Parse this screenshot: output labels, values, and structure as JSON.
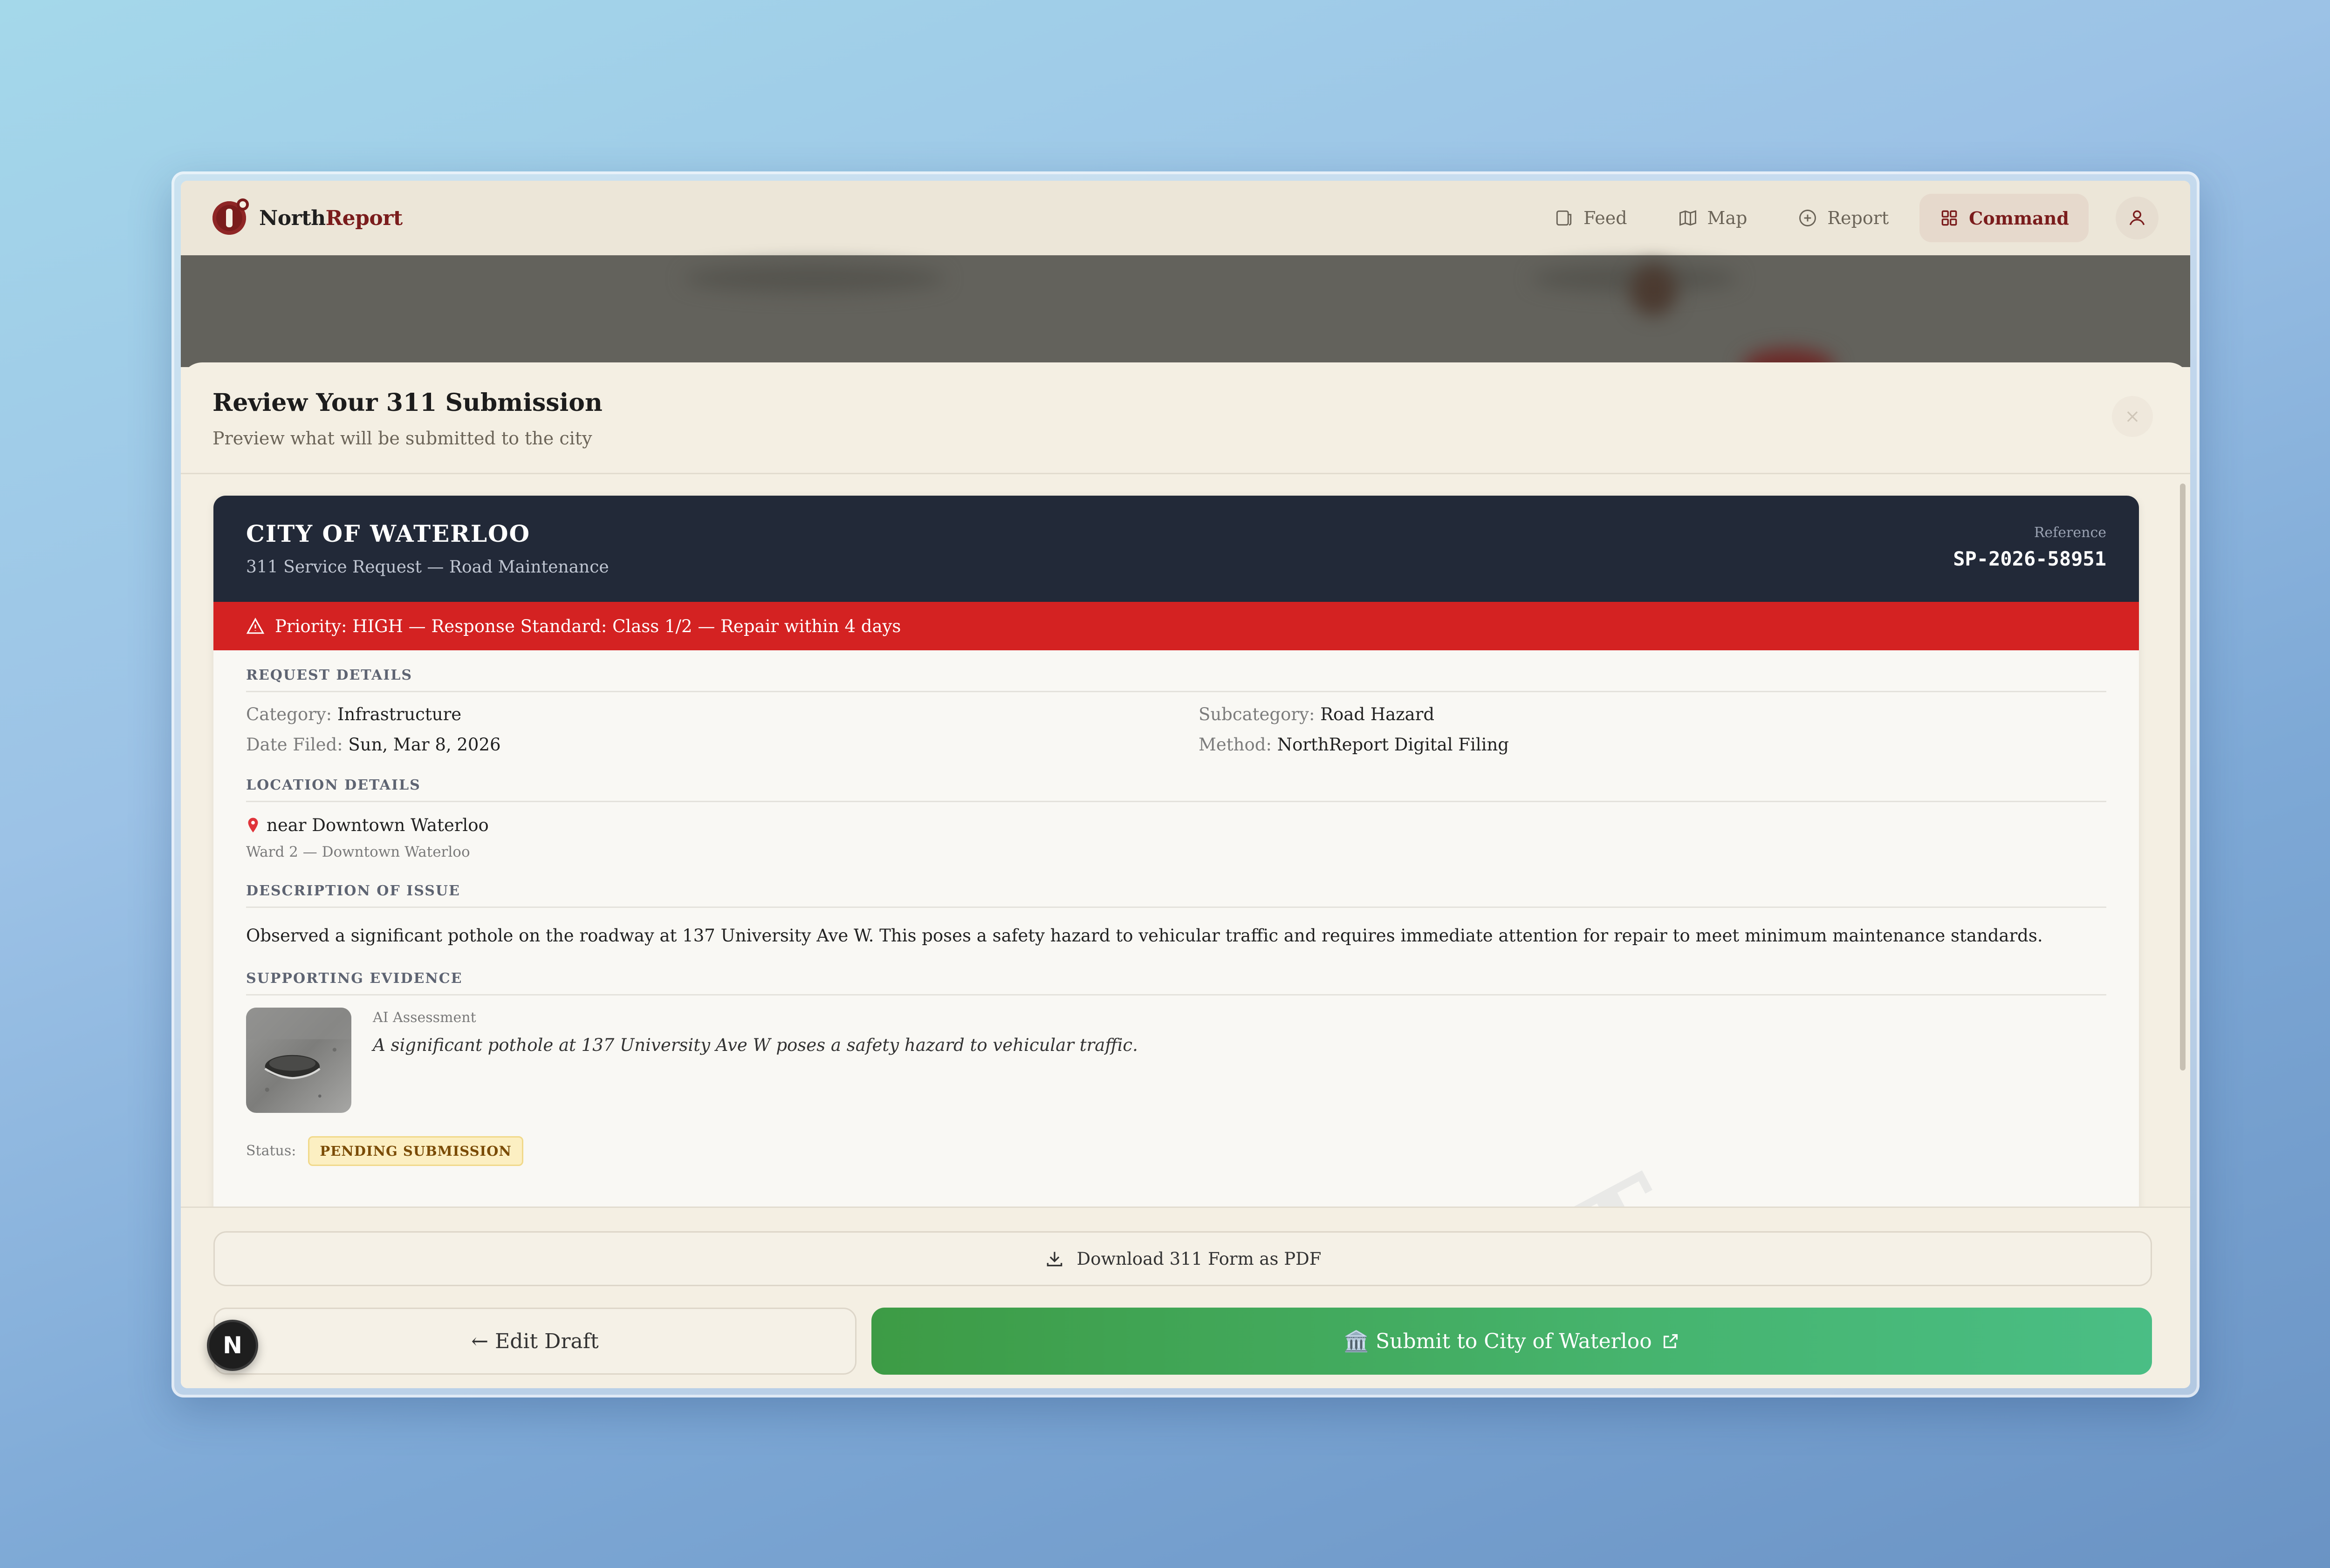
{
  "app": {
    "brand_primary": "North",
    "brand_accent": "Report",
    "accent_color": "#7a1c1c"
  },
  "nav": {
    "items": [
      {
        "label": "Feed",
        "icon": "feed-icon"
      },
      {
        "label": "Map",
        "icon": "map-icon"
      },
      {
        "label": "Report",
        "icon": "plus-circle-icon"
      },
      {
        "label": "Command",
        "icon": "grid-icon",
        "active": true
      }
    ]
  },
  "sheet": {
    "title": "Review Your 311 Submission",
    "subtitle": "Preview what will be submitted to the city",
    "close_icon": "×"
  },
  "form": {
    "city": "CITY OF WATERLOO",
    "service": "311 Service Request — Road Maintenance",
    "reference_label": "Reference",
    "reference_value": "SP-2026-58951",
    "priority": "Priority: HIGH — Response Standard: Class 1/2 — Repair within 4 days",
    "watermark": "DRAFT",
    "request_details": {
      "label": "REQUEST DETAILS",
      "category_k": "Category:",
      "category_v": "Infrastructure",
      "subcategory_k": "Subcategory:",
      "subcategory_v": "Road Hazard",
      "date_k": "Date Filed:",
      "date_v": "Sun, Mar 8, 2026",
      "method_k": "Method:",
      "method_v": "NorthReport Digital Filing"
    },
    "location": {
      "label": "LOCATION DETAILS",
      "place": "near Downtown Waterloo",
      "ward": "Ward 2 — Downtown Waterloo"
    },
    "description": {
      "label": "DESCRIPTION OF ISSUE",
      "text": "Observed a significant pothole on the roadway at 137 University Ave W. This poses a safety hazard to vehicular traffic and requires immediate attention for repair to meet minimum maintenance standards."
    },
    "evidence": {
      "label": "SUPPORTING EVIDENCE",
      "ai_label": "AI Assessment",
      "ai_text": "A significant pothole at 137 University Ave W poses a safety hazard to vehicular traffic."
    },
    "status": {
      "label": "Status:",
      "value": "PENDING SUBMISSION"
    }
  },
  "footer": {
    "download_label": "Download 311 Form as PDF",
    "edit_label": "← Edit Draft",
    "submit_label": "🏛️ Submit to City of Waterloo",
    "fab_letter": "N"
  }
}
